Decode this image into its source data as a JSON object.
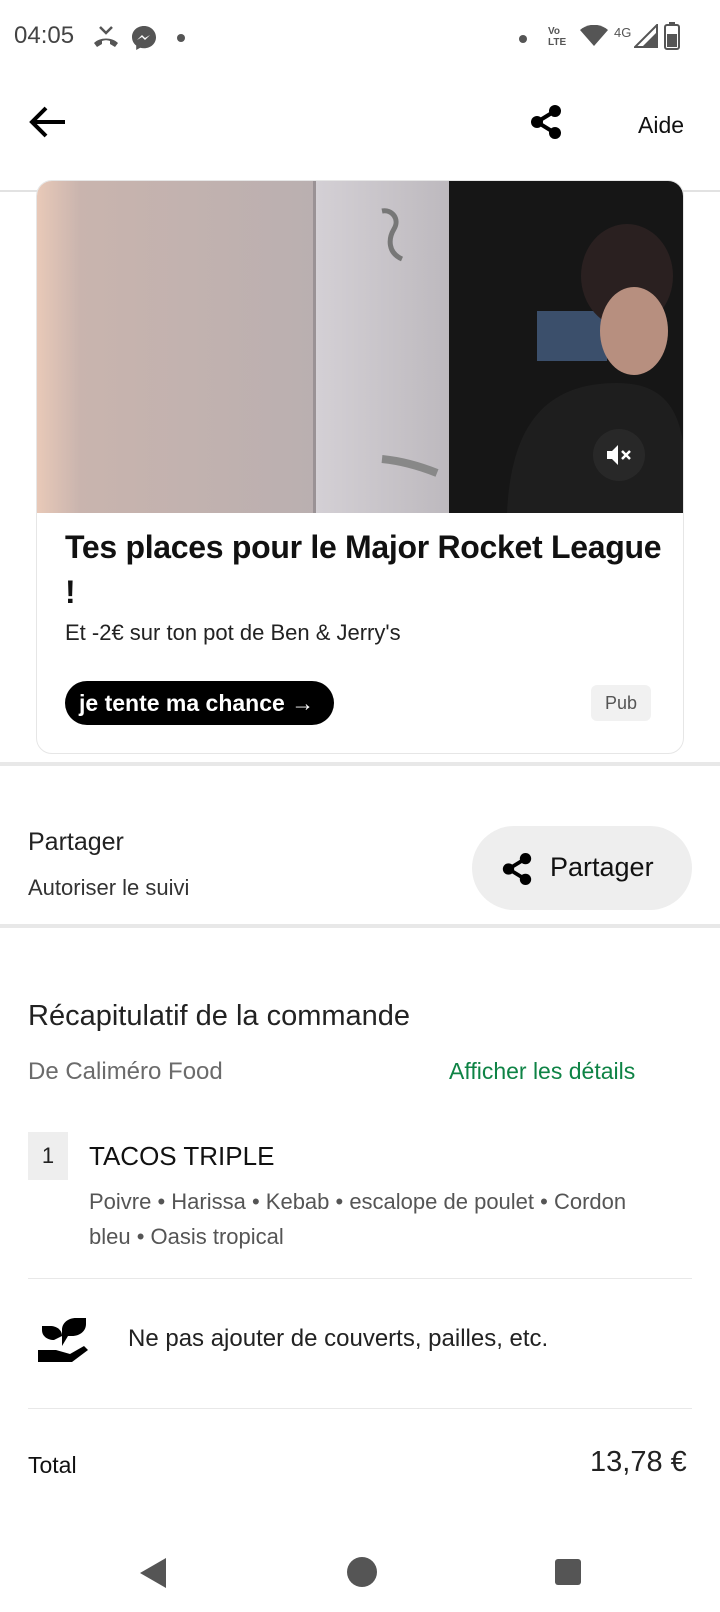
{
  "status_bar": {
    "time": "04:05",
    "network": "4G",
    "volte": "Vo LTE",
    "icons": [
      "missed-call-icon",
      "messenger-icon",
      "dot-icon",
      "dot-icon",
      "volte-icon",
      "wifi-icon",
      "signal-icon",
      "battery-icon"
    ]
  },
  "topbar": {
    "help_label": "Aide",
    "icons": [
      "back-arrow-icon",
      "share-icon"
    ]
  },
  "ad": {
    "title": "Tes places pour le Major Rocket League !",
    "subtitle": "Et -2€ sur ton pot de Ben & Jerry's",
    "cta_label": "je tente ma chance →",
    "badge": "Pub",
    "icons": [
      "mute-icon"
    ]
  },
  "share": {
    "title": "Partager",
    "subtitle": "Autoriser le suivi",
    "button_label": "Partager"
  },
  "order": {
    "title": "Récapitulatif de la commande",
    "restaurant": "De Caliméro Food",
    "details_link": "Afficher les détails",
    "items": [
      {
        "quantity": "1",
        "name": "TACOS TRIPLE",
        "options": "Poivre • Harissa • Kebab • escalope de poulet • Cordon bleu • Oasis tropical"
      }
    ],
    "cutlery_label": "Ne pas ajouter de couverts, pailles, etc.",
    "total_label": "Total",
    "total_value": "13,78 €"
  },
  "colors": {
    "accent_green": "#0e8345",
    "cta_black": "#000000",
    "pill_gray": "#eeeeee"
  }
}
